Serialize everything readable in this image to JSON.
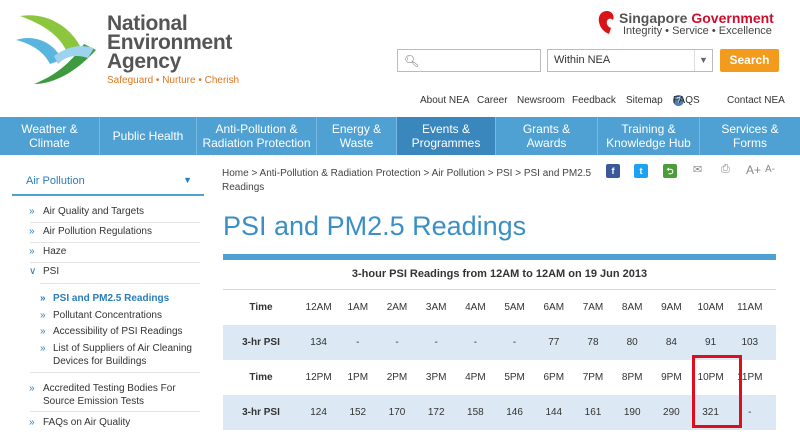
{
  "header": {
    "logo_lines": [
      "National",
      "Environment",
      "Agency"
    ],
    "logo_tagline": "Safeguard • Nurture • Cherish",
    "gov_title_a": "Singapore",
    "gov_title_b": "Government",
    "gov_subtitle": "Integrity • Service • Excellence",
    "search_placeholder": "",
    "search_scope": "Within NEA",
    "search_button": "Search"
  },
  "top_links": [
    "About NEA",
    "Career",
    "Newsroom",
    "Feedback",
    "Sitemap",
    "FAQS",
    "Contact NEA"
  ],
  "nav": [
    {
      "label": "Weather & Climate"
    },
    {
      "label": "Public Health"
    },
    {
      "label": "Anti-Pollution & Radiation Protection"
    },
    {
      "label": "Energy & Waste"
    },
    {
      "label": "Events & Programmes"
    },
    {
      "label": "Grants & Awards"
    },
    {
      "label": "Training & Knowledge Hub"
    },
    {
      "label": "Services & Forms"
    }
  ],
  "sidebar": {
    "heading": "Air Pollution",
    "items": [
      "Air Quality and Targets",
      "Air Pollution Regulations",
      "Haze",
      "PSI",
      "PSI and PM2.5 Readings",
      "Pollutant Concentrations",
      "Accessibility of PSI Readings",
      "List of Suppliers of Air Cleaning Devices for Buildings",
      "Accredited Testing Bodies For Source Emission Tests",
      "FAQs on Air Quality"
    ]
  },
  "breadcrumb": "Home > Anti-Pollution & Radiation Protection > Air Pollution > PSI > PSI and PM2.5 Readings",
  "share": {
    "fb": "f",
    "tw": "t",
    "font_up": "A+",
    "font_down": "A-"
  },
  "page_title": "PSI and PM2.5 Readings",
  "table": {
    "caption": "3-hour PSI Readings from 12AM to 12AM on 19 Jun 2013",
    "time_label": "Time",
    "psi_label": "3-hr PSI",
    "am_times": [
      "12AM",
      "1AM",
      "2AM",
      "3AM",
      "4AM",
      "5AM",
      "6AM",
      "7AM",
      "8AM",
      "9AM",
      "10AM",
      "11AM"
    ],
    "am_values": [
      "134",
      "-",
      "-",
      "-",
      "-",
      "-",
      "77",
      "78",
      "80",
      "84",
      "91",
      "103"
    ],
    "pm_times": [
      "12PM",
      "1PM",
      "2PM",
      "3PM",
      "4PM",
      "5PM",
      "6PM",
      "7PM",
      "8PM",
      "9PM",
      "10PM",
      "11PM"
    ],
    "pm_values": [
      "124",
      "152",
      "170",
      "172",
      "158",
      "146",
      "144",
      "161",
      "190",
      "290",
      "321",
      "-"
    ]
  }
}
